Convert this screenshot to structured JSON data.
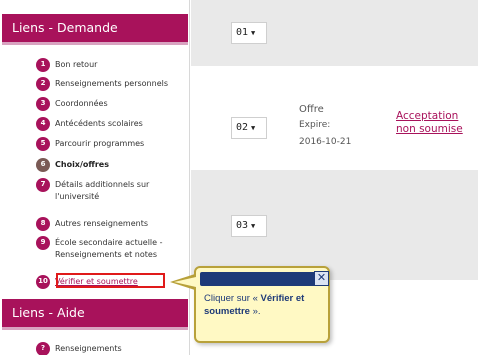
{
  "sidebar": {
    "demande_header": "Liens - Demande",
    "items": [
      {
        "label": "Bon retour"
      },
      {
        "label": "Renseignements personnels"
      },
      {
        "label": "Coordonnées"
      },
      {
        "label": "Antécédents scolaires"
      },
      {
        "label": "Parcourir programmes"
      },
      {
        "label": "Choix/offres"
      },
      {
        "label": "Détails additionnels sur l'université"
      },
      {
        "label": "Autres renseignements"
      },
      {
        "label": "École secondaire actuelle - Renseignements et notes"
      },
      {
        "label": "Vérifier et soumettre"
      }
    ],
    "aide_header": "Liens - Aide",
    "aide_items": [
      {
        "label": "Renseignements"
      }
    ]
  },
  "choices": [
    {
      "select_value": "01",
      "offer_label": "",
      "expire_label": "",
      "expire_date": "",
      "status": ""
    },
    {
      "select_value": "02",
      "offer_label": "Offre",
      "expire_label": "Expire:",
      "expire_date": "2016-10-21",
      "status": "Acceptation non soumise"
    },
    {
      "select_value": "03",
      "offer_label": "",
      "expire_label": "",
      "expire_date": "",
      "status": ""
    }
  ],
  "tooltip": {
    "text_before": "Cliquer sur « ",
    "text_bold": "Vérifier et soumettre",
    "text_after": " »."
  },
  "colors": {
    "accent": "#a8125b",
    "row_band": "#e9e9e9",
    "tooltip_bg": "#fff9c4",
    "tooltip_title": "#1e3a78"
  },
  "icons": {
    "step": "numbered-circle-icon",
    "close": "close-icon",
    "caret": "caret-down-icon"
  }
}
